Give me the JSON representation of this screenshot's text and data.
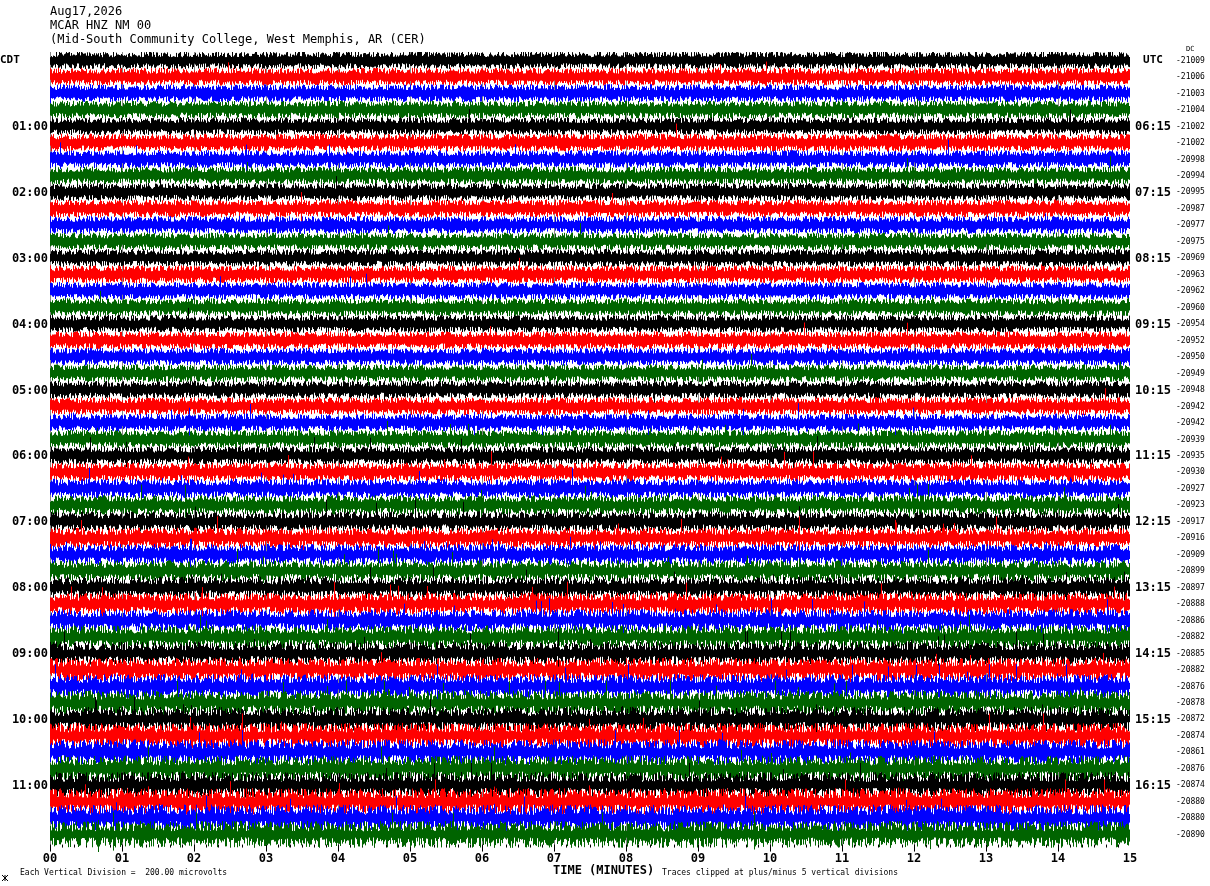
{
  "header": {
    "date": "Aug17,2026",
    "station": "MCAR HNZ NM 00",
    "location": "(Mid-South Community College, West Memphis, AR (CER)"
  },
  "left_axis_title": "CDT",
  "right_axis_title": "UTC",
  "dc_header": "DC",
  "rows": [
    {
      "color": "#000000",
      "dc": "-21009"
    },
    {
      "color": "#ff0000",
      "dc": "-21006"
    },
    {
      "color": "#0000ff",
      "dc": "-21003"
    },
    {
      "color": "#006400",
      "dc": "-21004"
    },
    {
      "color": "#000000",
      "dc": "-21002",
      "local_time": "01:00",
      "utc_time": "06:15"
    },
    {
      "color": "#ff0000",
      "dc": "-21002"
    },
    {
      "color": "#0000ff",
      "dc": "-20998"
    },
    {
      "color": "#006400",
      "dc": "-20994"
    },
    {
      "color": "#000000",
      "dc": "-20995",
      "local_time": "02:00",
      "utc_time": "07:15"
    },
    {
      "color": "#ff0000",
      "dc": "-20987"
    },
    {
      "color": "#0000ff",
      "dc": "-20977"
    },
    {
      "color": "#006400",
      "dc": "-20975"
    },
    {
      "color": "#000000",
      "dc": "-20969",
      "local_time": "03:00",
      "utc_time": "08:15"
    },
    {
      "color": "#ff0000",
      "dc": "-20963"
    },
    {
      "color": "#0000ff",
      "dc": "-20962"
    },
    {
      "color": "#006400",
      "dc": "-20960"
    },
    {
      "color": "#000000",
      "dc": "-20954",
      "local_time": "04:00",
      "utc_time": "09:15"
    },
    {
      "color": "#ff0000",
      "dc": "-20952"
    },
    {
      "color": "#0000ff",
      "dc": "-20950"
    },
    {
      "color": "#006400",
      "dc": "-20949"
    },
    {
      "color": "#000000",
      "dc": "-20948",
      "local_time": "05:00",
      "utc_time": "10:15"
    },
    {
      "color": "#ff0000",
      "dc": "-20942"
    },
    {
      "color": "#0000ff",
      "dc": "-20942"
    },
    {
      "color": "#006400",
      "dc": "-20939"
    },
    {
      "color": "#000000",
      "dc": "-20935",
      "local_time": "06:00",
      "utc_time": "11:15"
    },
    {
      "color": "#ff0000",
      "dc": "-20930"
    },
    {
      "color": "#0000ff",
      "dc": "-20927"
    },
    {
      "color": "#006400",
      "dc": "-20923"
    },
    {
      "color": "#000000",
      "dc": "-20917",
      "local_time": "07:00",
      "utc_time": "12:15"
    },
    {
      "color": "#ff0000",
      "dc": "-20916"
    },
    {
      "color": "#0000ff",
      "dc": "-20909"
    },
    {
      "color": "#006400",
      "dc": "-20899"
    },
    {
      "color": "#000000",
      "dc": "-20897",
      "local_time": "08:00",
      "utc_time": "13:15"
    },
    {
      "color": "#ff0000",
      "dc": "-20888"
    },
    {
      "color": "#0000ff",
      "dc": "-20886"
    },
    {
      "color": "#006400",
      "dc": "-20882"
    },
    {
      "color": "#000000",
      "dc": "-20885",
      "local_time": "09:00",
      "utc_time": "14:15"
    },
    {
      "color": "#ff0000",
      "dc": "-20882"
    },
    {
      "color": "#0000ff",
      "dc": "-20876"
    },
    {
      "color": "#006400",
      "dc": "-20878"
    },
    {
      "color": "#000000",
      "dc": "-20872",
      "local_time": "10:00",
      "utc_time": "15:15"
    },
    {
      "color": "#ff0000",
      "dc": "-20874"
    },
    {
      "color": "#0000ff",
      "dc": "-20861"
    },
    {
      "color": "#006400",
      "dc": "-20876"
    },
    {
      "color": "#000000",
      "dc": "-20874",
      "local_time": "11:00",
      "utc_time": "16:15"
    },
    {
      "color": "#ff0000",
      "dc": "-20880"
    },
    {
      "color": "#0000ff",
      "dc": "-20880"
    },
    {
      "color": "#006400",
      "dc": "-20890"
    }
  ],
  "x_ticks": [
    "00",
    "01",
    "02",
    "03",
    "04",
    "05",
    "06",
    "07",
    "08",
    "09",
    "10",
    "11",
    "12",
    "13",
    "14",
    "15"
  ],
  "x_axis_title": "TIME (MINUTES)",
  "scale_note": "Each Vertical Division =  200.00 microvolts",
  "clip_note": "Traces clipped at plus/minus 5 vertical divisions"
}
